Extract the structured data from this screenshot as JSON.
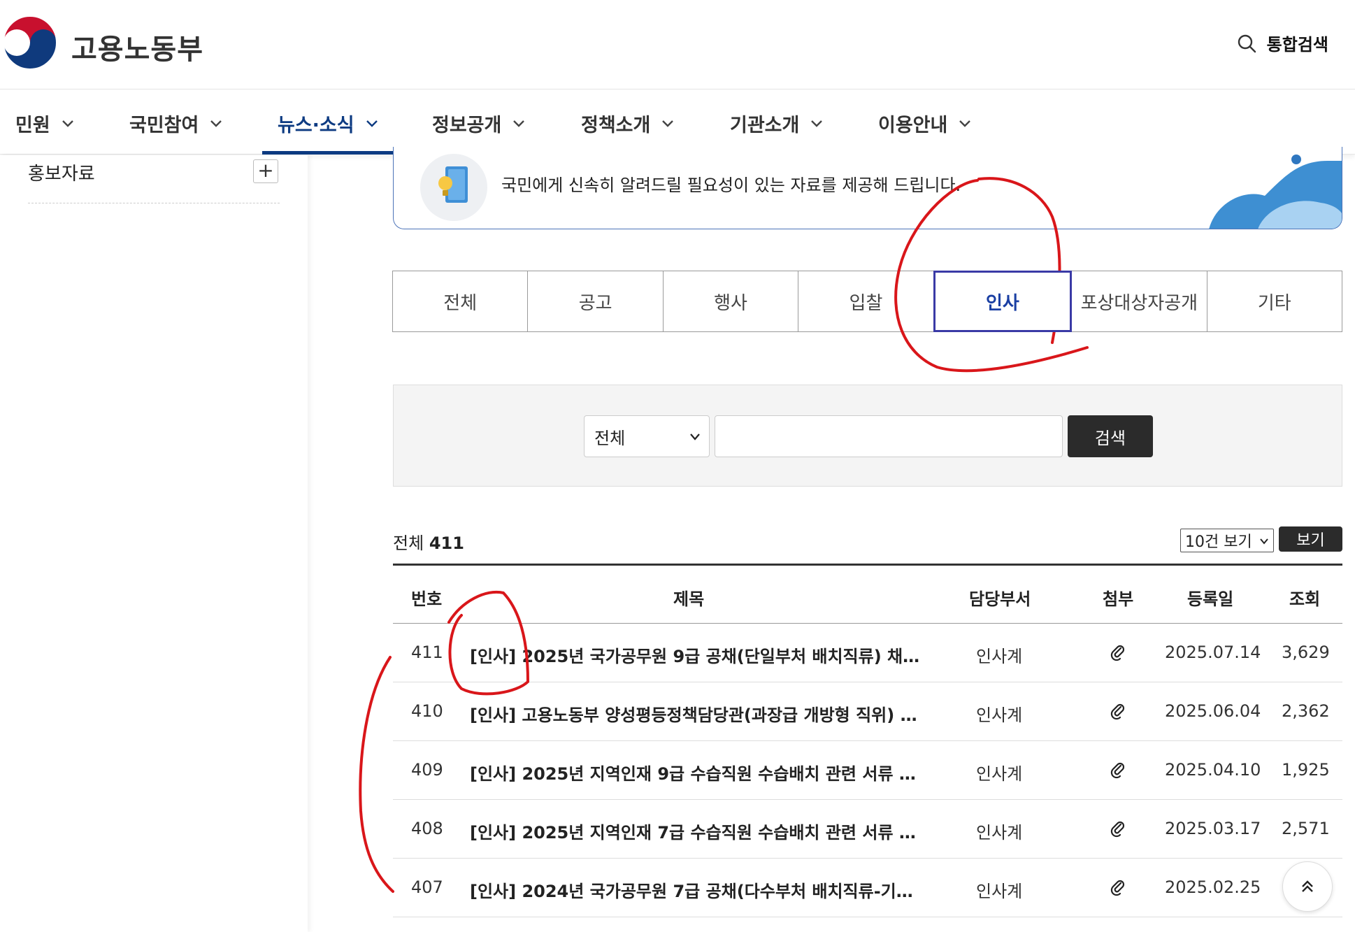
{
  "header": {
    "logo_text": "고용노동부",
    "search_label": "통합검색"
  },
  "nav": {
    "items": [
      {
        "label": "민원"
      },
      {
        "label": "국민참여"
      },
      {
        "label": "뉴스·소식",
        "active": true
      },
      {
        "label": "정보공개"
      },
      {
        "label": "정책소개"
      },
      {
        "label": "기관소개"
      },
      {
        "label": "이용안내"
      }
    ]
  },
  "sidebar": {
    "item_label": "홍보자료",
    "expand_symbol": "+"
  },
  "banner": {
    "text": "국민에게 신속히 알려드릴 필요성이 있는 자료를 제공해 드립니다."
  },
  "tabs": [
    {
      "label": "전체"
    },
    {
      "label": "공고"
    },
    {
      "label": "행사"
    },
    {
      "label": "입찰"
    },
    {
      "label": "인사",
      "active": true
    },
    {
      "label": "포상대상자공개"
    },
    {
      "label": "기타"
    }
  ],
  "search": {
    "select_value": "전체",
    "input_value": "",
    "button_label": "검색"
  },
  "list_info": {
    "total_label": "전체",
    "total_count": "411",
    "per_page_value": "10건 보기",
    "view_button": "보기"
  },
  "table": {
    "headers": [
      "번호",
      "제목",
      "담당부서",
      "첨부",
      "등록일",
      "조회"
    ],
    "rows": [
      {
        "no": "411",
        "title": "[인사] 2025년 국가공무원 9급 공채(단일부처 배치직류) 채…",
        "dept": "인사계",
        "date": "2025.07.14",
        "views": "3,629"
      },
      {
        "no": "410",
        "title": "[인사] 고용노동부 양성평등정책담당관(과장급 개방형 직위) …",
        "dept": "인사계",
        "date": "2025.06.04",
        "views": "2,362"
      },
      {
        "no": "409",
        "title": "[인사] 2025년 지역인재 9급 수습직원 수습배치 관련 서류 …",
        "dept": "인사계",
        "date": "2025.04.10",
        "views": "1,925"
      },
      {
        "no": "408",
        "title": "[인사] 2025년 지역인재 7급 수습직원 수습배치 관련 서류 …",
        "dept": "인사계",
        "date": "2025.03.17",
        "views": "2,571"
      },
      {
        "no": "407",
        "title": "[인사] 2024년 국가공무원 7급 공채(다수부처 배치직류-기…",
        "dept": "인사계",
        "date": "2025.02.25",
        "views": ""
      }
    ]
  },
  "colors": {
    "brand_navy": "#0d3b82",
    "tab_active_border": "#3a3aa6",
    "annotation_red": "#d9161a"
  }
}
